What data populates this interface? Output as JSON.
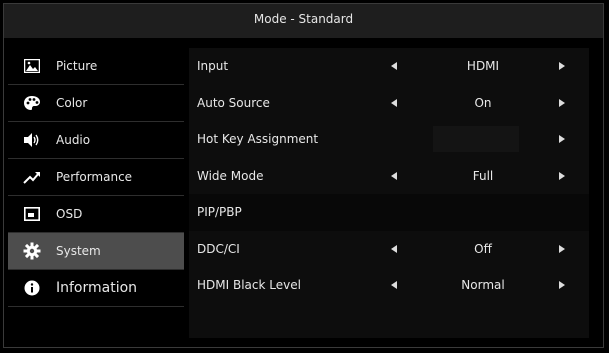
{
  "header": {
    "title": "Mode - Standard"
  },
  "sidebar": {
    "items": [
      {
        "label": "Picture",
        "icon": "picture-icon"
      },
      {
        "label": "Color",
        "icon": "palette-icon"
      },
      {
        "label": "Audio",
        "icon": "speaker-icon"
      },
      {
        "label": "Performance",
        "icon": "trend-icon"
      },
      {
        "label": "OSD",
        "icon": "osd-icon"
      },
      {
        "label": "System",
        "icon": "gear-icon",
        "active": true
      },
      {
        "label": "Information",
        "icon": "info-icon"
      }
    ]
  },
  "main": {
    "rows": [
      {
        "label": "Input",
        "value": "HDMI"
      },
      {
        "label": "Auto Source",
        "value": "On"
      },
      {
        "label": "Hot Key Assignment",
        "value": ""
      },
      {
        "label": "Wide Mode",
        "value": "Full"
      },
      {
        "label": "PIP/PBP",
        "value": ""
      },
      {
        "label": "DDC/CI",
        "value": "Off"
      },
      {
        "label": "HDMI Black Level",
        "value": "Normal"
      }
    ]
  },
  "colors": {
    "active_bg": "#4d4d4d",
    "panel_bg": "#0d0d0d",
    "title_bg": "#1e1e1e"
  }
}
